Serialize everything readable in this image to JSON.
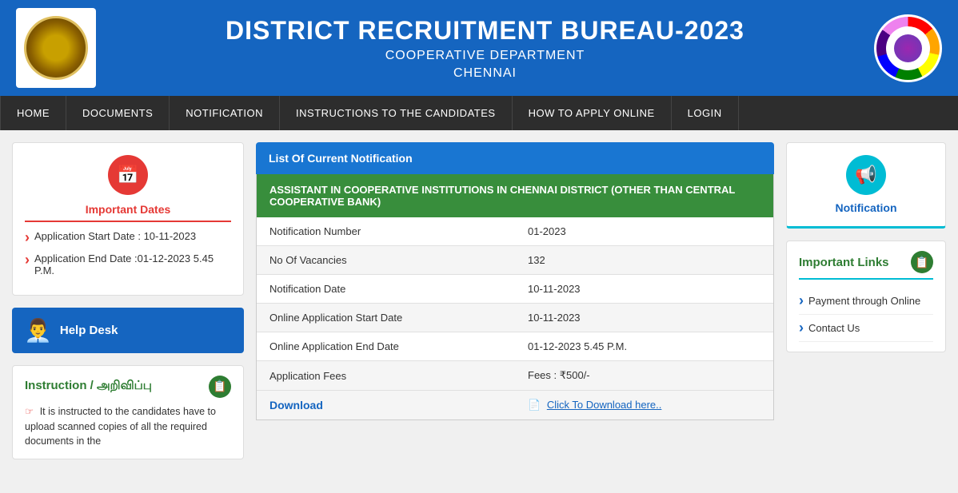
{
  "header": {
    "title": "DISTRICT RECRUITMENT BUREAU-2023",
    "subtitle1": "COOPERATIVE DEPARTMENT",
    "subtitle2": "CHENNAI"
  },
  "navbar": {
    "items": [
      {
        "label": "HOME",
        "active": false
      },
      {
        "label": "DOCUMENTS",
        "active": false
      },
      {
        "label": "NOTIFICATION",
        "active": false
      },
      {
        "label": "INSTRUCTIONS TO THE CANDIDATES",
        "active": true
      },
      {
        "label": "HOW TO APPLY ONLINE",
        "active": false
      },
      {
        "label": "LOGIN",
        "active": false
      }
    ]
  },
  "sidebar_left": {
    "important_dates_title": "Important Dates",
    "date_items": [
      "Application Start Date : 10-11-2023",
      "Application End Date :01-12-2023 5.45 P.M."
    ],
    "helpdesk_label": "Help Desk",
    "instruction_title": "Instruction / அறிவிப்பு",
    "instruction_text": "It is instructed to the candidates have to upload scanned copies of all the required documents in the"
  },
  "center": {
    "list_header": "List Of Current Notification",
    "green_title": "ASSISTANT IN COOPERATIVE INSTITUTIONS IN CHENNAI DISTRICT (OTHER THAN CENTRAL COOPERATIVE BANK)",
    "table_rows": [
      {
        "label": "Notification Number",
        "value": "01-2023"
      },
      {
        "label": "No Of Vacancies",
        "value": "132"
      },
      {
        "label": "Notification Date",
        "value": "10-11-2023"
      },
      {
        "label": "Online Application Start Date",
        "value": "10-11-2023"
      },
      {
        "label": "Online Application End Date",
        "value": "01-12-2023 5.45 P.M."
      },
      {
        "label": "Application Fees",
        "value": "Fees : ₹500/-"
      }
    ],
    "download_label": "Download",
    "download_link": "Click To Download here.."
  },
  "sidebar_right": {
    "notification_label": "Notification",
    "important_links_title": "Important Links",
    "links": [
      "Payment through Online",
      "Contact Us"
    ]
  }
}
